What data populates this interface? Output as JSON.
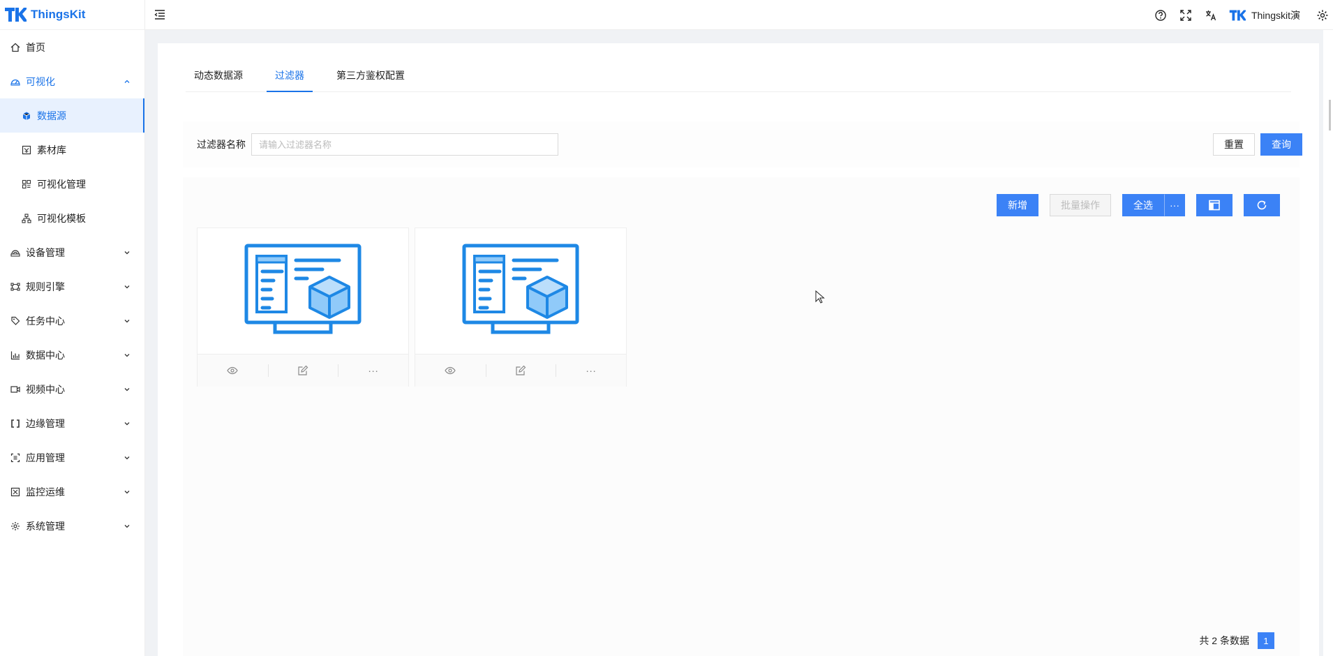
{
  "app": {
    "logo_text": "ThingsKit"
  },
  "sidebar": {
    "items": [
      {
        "label": "首页",
        "icon": "home-icon"
      },
      {
        "label": "可视化",
        "icon": "dashboard-icon"
      },
      {
        "label": "数据源",
        "icon": "datasource-icon"
      },
      {
        "label": "素材库",
        "icon": "material-icon"
      },
      {
        "label": "可视化管理",
        "icon": "visual-manage-icon"
      },
      {
        "label": "可视化模板",
        "icon": "template-icon"
      },
      {
        "label": "设备管理",
        "icon": "device-icon"
      },
      {
        "label": "规则引擎",
        "icon": "rule-engine-icon"
      },
      {
        "label": "任务中心",
        "icon": "task-icon"
      },
      {
        "label": "数据中心",
        "icon": "chart-icon"
      },
      {
        "label": "视频中心",
        "icon": "video-icon"
      },
      {
        "label": "边缘管理",
        "icon": "edge-icon"
      },
      {
        "label": "应用管理",
        "icon": "app-icon"
      },
      {
        "label": "监控运维",
        "icon": "monitor-icon"
      },
      {
        "label": "系统管理",
        "icon": "gear-icon"
      }
    ]
  },
  "header": {
    "username": "Thingskit演"
  },
  "tabs": [
    "动态数据源",
    "过滤器",
    "第三方鉴权配置"
  ],
  "search": {
    "label": "过滤器名称",
    "placeholder": "请输入过滤器名称",
    "value": "",
    "reset_label": "重置",
    "query_label": "查询"
  },
  "toolbar": {
    "add_label": "新增",
    "batch_label": "批量操作",
    "select_all_label": "全选",
    "more_label": "···"
  },
  "cards": [
    {
      "thumbnail": "dashboard-thumbnail"
    },
    {
      "thumbnail": "dashboard-thumbnail"
    }
  ],
  "card_actions": {
    "more_label": "···"
  },
  "pagination": {
    "total_text": "共 2 条数据",
    "current_page": "1"
  },
  "colors": {
    "primary": "#3b82f6",
    "brand": "#1a73e8"
  }
}
